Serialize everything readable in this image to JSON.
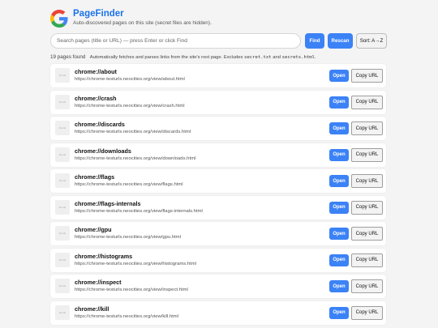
{
  "app": {
    "title": "PageFinder",
    "subtitle": "Auto-discovered pages on this site (secret files are hidden).",
    "logo_icon": "google-g-icon"
  },
  "search": {
    "placeholder": "Search pages (title or URL) — press Enter or click Find"
  },
  "toolbar": {
    "find_label": "Find",
    "rescan_label": "Rescan",
    "sort_label": "Sort: A→Z"
  },
  "summary": {
    "count_text": "19 pages found",
    "note_prefix": "Automatically fetches and parses links from the site's root page. Excludes",
    "excluded_1": "secret.txt",
    "and_text": "and",
    "excluded_2": "secrets.html",
    "period": "."
  },
  "row_labels": {
    "open": "Open",
    "copy": "Copy URL",
    "thumb": "thumb"
  },
  "pages": [
    {
      "title": "chrome://about",
      "url": "https://chrome-testurls.neocities.org/view/about.html"
    },
    {
      "title": "chrome://crash",
      "url": "https://chrome-testurls.neocities.org/view/crash.html"
    },
    {
      "title": "chrome://discards",
      "url": "https://chrome-testurls.neocities.org/view/discards.html"
    },
    {
      "title": "chrome://downloads",
      "url": "https://chrome-testurls.neocities.org/view/downloads.html"
    },
    {
      "title": "chrome://flags",
      "url": "https://chrome-testurls.neocities.org/view/flags.html"
    },
    {
      "title": "chrome://flags-internals",
      "url": "https://chrome-testurls.neocities.org/view/flags-internals.html"
    },
    {
      "title": "chrome://gpu",
      "url": "https://chrome-testurls.neocities.org/view/gpu.html"
    },
    {
      "title": "chrome://histograms",
      "url": "https://chrome-testurls.neocities.org/view/histograms.html"
    },
    {
      "title": "chrome://inspect",
      "url": "https://chrome-testurls.neocities.org/view/inspect.html"
    },
    {
      "title": "chrome://kill",
      "url": "https://chrome-testurls.neocities.org/view/kill.html"
    }
  ],
  "colors": {
    "accent": "#3b82f6",
    "brand_title": "#1a73e8",
    "background": "#f4f4f5"
  }
}
